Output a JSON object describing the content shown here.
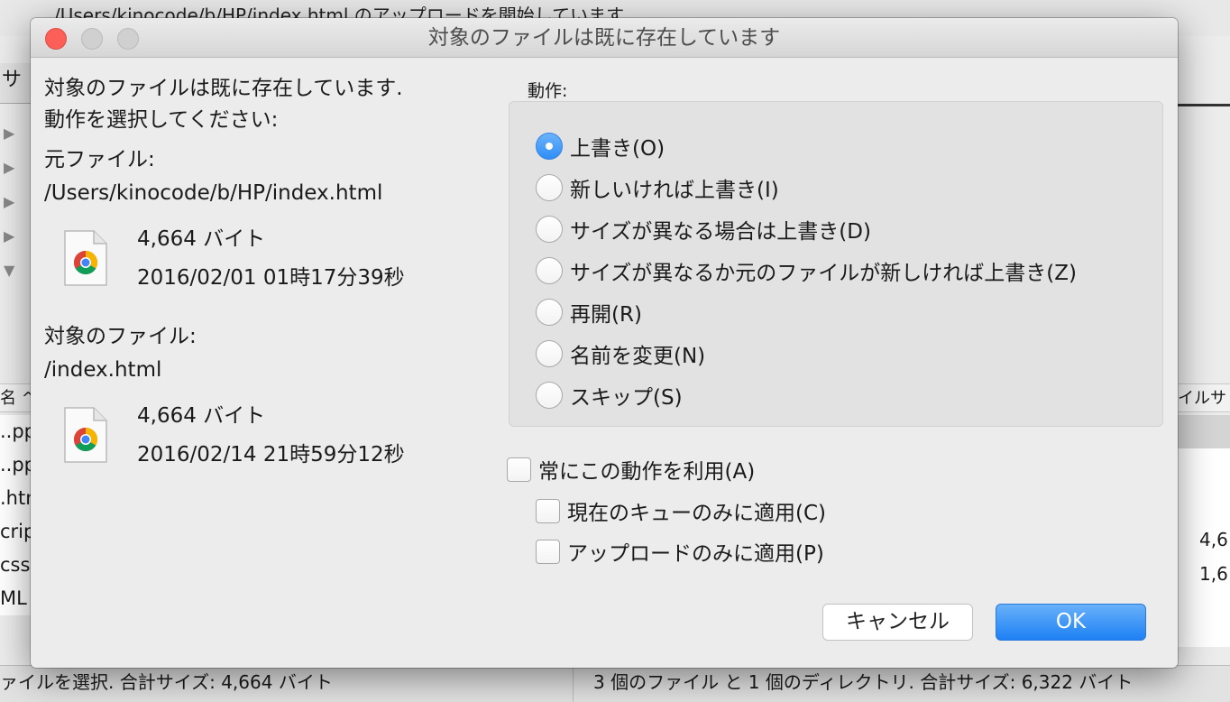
{
  "background": {
    "log_line": "/Users/kinocode/b/HP/index.html のアップロードを開始しています",
    "left_tab": "サ",
    "left_header": "名 ^",
    "left_rows": [
      "..pp",
      "..pp",
      ".htm",
      "crip",
      "css",
      "ML"
    ],
    "right_header": "イルサ",
    "right_sizes": [
      "4,6",
      "1,6"
    ],
    "status_left": "ァイルを選択. 合計サイズ: 4,664 バイト",
    "status_right": "3 個のファイル と 1 個のディレクトリ. 合計サイズ: 6,322 バイト"
  },
  "dialog": {
    "title": "対象のファイルは既に存在しています",
    "message_line1": "対象のファイルは既に存在しています.",
    "message_line2": "動作を選択してください:",
    "source": {
      "label": "元ファイル:",
      "path": "/Users/kinocode/b/HP/index.html",
      "size": "4,664 バイト",
      "date": "2016/02/01 01時17分39秒",
      "icon": "chrome-html-file-icon"
    },
    "target": {
      "label": "対象のファイル:",
      "path": "/index.html",
      "size": "4,664 バイト",
      "date": "2016/02/14 21時59分12秒",
      "icon": "chrome-html-file-icon"
    },
    "action_label": "動作:",
    "actions": [
      {
        "label": "上書き(O)",
        "selected": true
      },
      {
        "label": "新しいければ上書き(I)",
        "selected": false
      },
      {
        "label": "サイズが異なる場合は上書き(D)",
        "selected": false
      },
      {
        "label": "サイズが異なるか元のファイルが新しければ上書き(Z)",
        "selected": false
      },
      {
        "label": "再開(R)",
        "selected": false
      },
      {
        "label": "名前を変更(N)",
        "selected": false
      },
      {
        "label": "スキップ(S)",
        "selected": false
      }
    ],
    "always_use": {
      "label": "常にこの動作を利用(A)",
      "checked": false
    },
    "queue_only": {
      "label": "現在のキューのみに適用(C)",
      "checked": false
    },
    "upload_only": {
      "label": "アップロードのみに適用(P)",
      "checked": false
    },
    "cancel_label": "キャンセル",
    "ok_label": "OK",
    "accent_color": "#2f8ef6"
  }
}
